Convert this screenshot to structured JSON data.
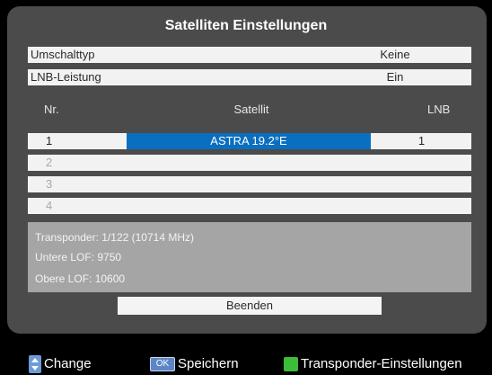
{
  "title": "Satelliten Einstellungen",
  "settings": [
    {
      "label": "Umschalttyp",
      "value": "Keine"
    },
    {
      "label": "LNB-Leistung",
      "value": "Ein"
    }
  ],
  "columns": {
    "nr": "Nr.",
    "satellite": "Satellit",
    "lnb": "LNB"
  },
  "satellites": [
    {
      "nr": "1",
      "name": "ASTRA 19.2°E",
      "lnb": "1",
      "selected": true
    },
    {
      "nr": "2",
      "name": "",
      "lnb": ""
    },
    {
      "nr": "3",
      "name": "",
      "lnb": ""
    },
    {
      "nr": "4",
      "name": "",
      "lnb": ""
    }
  ],
  "info": {
    "transponder": "Transponder: 1/122 (10714 MHz)",
    "lower_lof": "Untere LOF: 9750",
    "upper_lof": "Obere LOF: 10600"
  },
  "exit_button": "Beenden",
  "footer": {
    "change_label": "Change",
    "ok_icon_text": "OK",
    "save_label": "Speichern",
    "transponder_label": "Transponder-Einstellungen"
  },
  "icons": {
    "change": "up-down-arrow-icon",
    "save": "ok-key-icon",
    "transponder": "green-key-icon"
  },
  "colors": {
    "selection": "#0a6fc0",
    "panel": "#4b4b4b",
    "green_key": "#3dbb3a",
    "nav_key": "#6f9ad8"
  }
}
